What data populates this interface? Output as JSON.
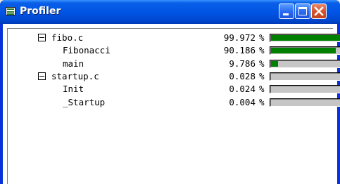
{
  "window": {
    "title": "Profiler"
  },
  "rows": [
    {
      "label": "fibo.c",
      "percent": "99.972",
      "sign": "%",
      "level": 0,
      "expander": true,
      "fraction": 0.99972
    },
    {
      "label": "Fibonacci",
      "percent": "90.186",
      "sign": "%",
      "level": 1,
      "expander": false,
      "fraction": 0.90186
    },
    {
      "label": "main",
      "percent": "9.786",
      "sign": "%",
      "level": 1,
      "expander": false,
      "fraction": 0.09786
    },
    {
      "label": "startup.c",
      "percent": "0.028",
      "sign": "%",
      "level": 0,
      "expander": true,
      "fraction": 0.00028
    },
    {
      "label": "Init",
      "percent": "0.024",
      "sign": "%",
      "level": 1,
      "expander": false,
      "fraction": 0.00024
    },
    {
      "label": "_Startup",
      "percent": "0.004",
      "sign": "%",
      "level": 1,
      "expander": false,
      "fraction": 4e-05
    }
  ],
  "colors": {
    "bar_fill": "#008000",
    "bar_track": "#c6c6c6",
    "titlebar": "#0055e5",
    "close_button": "#d9542b"
  },
  "icons": {
    "app": "profiler-window-icon",
    "minimize": "minimize-icon",
    "maximize": "maximize-icon",
    "close": "close-icon"
  }
}
